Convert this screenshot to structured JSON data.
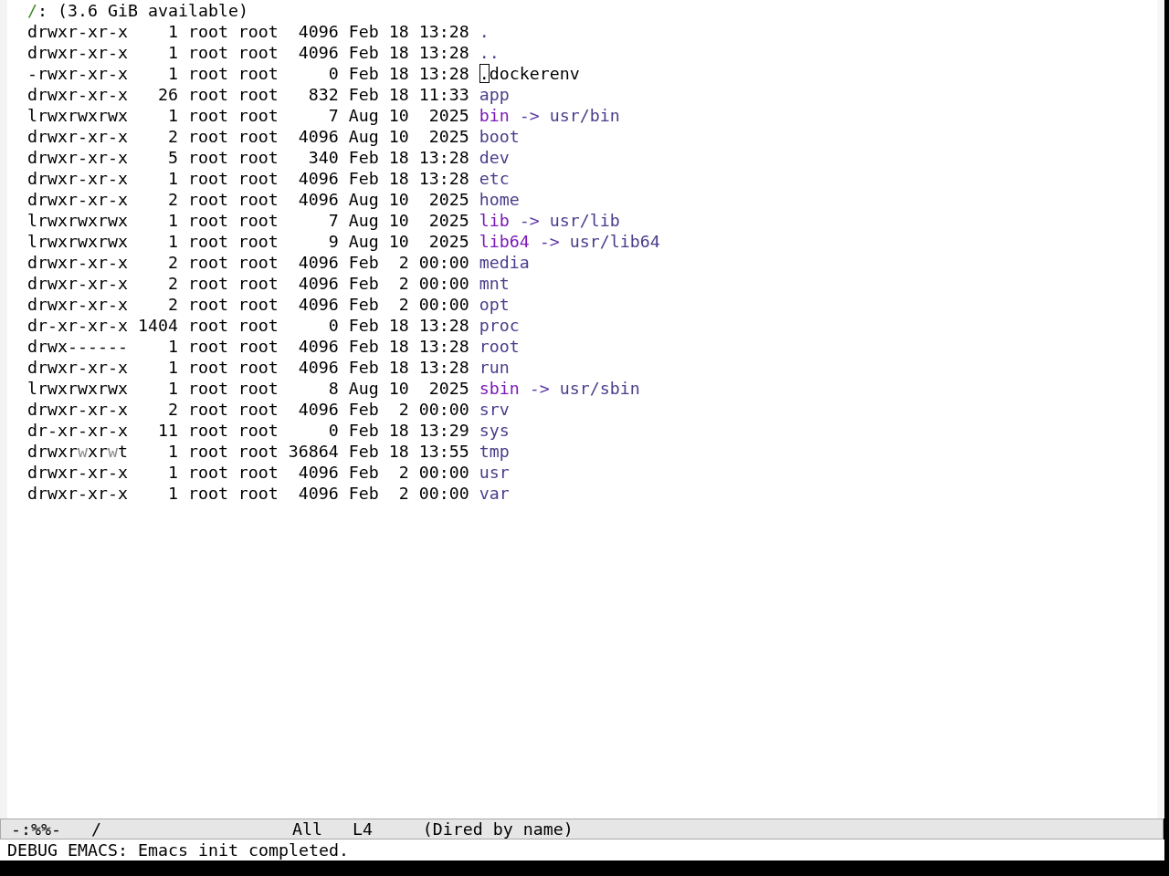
{
  "header": {
    "directory": "/",
    "info": ": (3.6 GiB available)"
  },
  "entries": [
    {
      "kind": "directory",
      "permissions": "drwxr-xr-x",
      "write_highlight": false,
      "links": "1",
      "owner": "root",
      "group": "root",
      "size": "4096",
      "date": "Feb 18 13:28",
      "name": ".",
      "cursor": false
    },
    {
      "kind": "directory",
      "permissions": "drwxr-xr-x",
      "write_highlight": false,
      "links": "1",
      "owner": "root",
      "group": "root",
      "size": "4096",
      "date": "Feb 18 13:28",
      "name": "..",
      "cursor": false
    },
    {
      "kind": "file",
      "permissions": "-rwxr-xr-x",
      "write_highlight": false,
      "links": "1",
      "owner": "root",
      "group": "root",
      "size": "0",
      "date": "Feb 18 13:28",
      "name": ".dockerenv",
      "cursor": true
    },
    {
      "kind": "directory",
      "permissions": "drwxr-xr-x",
      "write_highlight": false,
      "links": "26",
      "owner": "root",
      "group": "root",
      "size": "832",
      "date": "Feb 18 11:33",
      "name": "app",
      "cursor": false
    },
    {
      "kind": "symlink",
      "permissions": "lrwxrwxrwx",
      "write_highlight": false,
      "links": "1",
      "owner": "root",
      "group": "root",
      "size": "7",
      "date": "Aug 10  2025",
      "name": "bin",
      "arrow": "->",
      "target": "usr/bin",
      "cursor": false
    },
    {
      "kind": "directory",
      "permissions": "drwxr-xr-x",
      "write_highlight": false,
      "links": "2",
      "owner": "root",
      "group": "root",
      "size": "4096",
      "date": "Aug 10  2025",
      "name": "boot",
      "cursor": false
    },
    {
      "kind": "directory",
      "permissions": "drwxr-xr-x",
      "write_highlight": false,
      "links": "5",
      "owner": "root",
      "group": "root",
      "size": "340",
      "date": "Feb 18 13:28",
      "name": "dev",
      "cursor": false
    },
    {
      "kind": "directory",
      "permissions": "drwxr-xr-x",
      "write_highlight": false,
      "links": "1",
      "owner": "root",
      "group": "root",
      "size": "4096",
      "date": "Feb 18 13:28",
      "name": "etc",
      "cursor": false
    },
    {
      "kind": "directory",
      "permissions": "drwxr-xr-x",
      "write_highlight": false,
      "links": "2",
      "owner": "root",
      "group": "root",
      "size": "4096",
      "date": "Aug 10  2025",
      "name": "home",
      "cursor": false
    },
    {
      "kind": "symlink",
      "permissions": "lrwxrwxrwx",
      "write_highlight": false,
      "links": "1",
      "owner": "root",
      "group": "root",
      "size": "7",
      "date": "Aug 10  2025",
      "name": "lib",
      "arrow": "->",
      "target": "usr/lib",
      "cursor": false
    },
    {
      "kind": "symlink",
      "permissions": "lrwxrwxrwx",
      "write_highlight": false,
      "links": "1",
      "owner": "root",
      "group": "root",
      "size": "9",
      "date": "Aug 10  2025",
      "name": "lib64",
      "arrow": "->",
      "target": "usr/lib64",
      "cursor": false
    },
    {
      "kind": "directory",
      "permissions": "drwxr-xr-x",
      "write_highlight": false,
      "links": "2",
      "owner": "root",
      "group": "root",
      "size": "4096",
      "date": "Feb  2 00:00",
      "name": "media",
      "cursor": false
    },
    {
      "kind": "directory",
      "permissions": "drwxr-xr-x",
      "write_highlight": false,
      "links": "2",
      "owner": "root",
      "group": "root",
      "size": "4096",
      "date": "Feb  2 00:00",
      "name": "mnt",
      "cursor": false
    },
    {
      "kind": "directory",
      "permissions": "drwxr-xr-x",
      "write_highlight": false,
      "links": "2",
      "owner": "root",
      "group": "root",
      "size": "4096",
      "date": "Feb  2 00:00",
      "name": "opt",
      "cursor": false
    },
    {
      "kind": "directory",
      "permissions": "dr-xr-xr-x",
      "write_highlight": false,
      "links": "1404",
      "owner": "root",
      "group": "root",
      "size": "0",
      "date": "Feb 18 13:28",
      "name": "proc",
      "cursor": false
    },
    {
      "kind": "directory",
      "permissions": "drwx------",
      "write_highlight": false,
      "links": "1",
      "owner": "root",
      "group": "root",
      "size": "4096",
      "date": "Feb 18 13:28",
      "name": "root",
      "cursor": false
    },
    {
      "kind": "directory",
      "permissions": "drwxr-xr-x",
      "write_highlight": false,
      "links": "1",
      "owner": "root",
      "group": "root",
      "size": "4096",
      "date": "Feb 18 13:28",
      "name": "run",
      "cursor": false
    },
    {
      "kind": "symlink",
      "permissions": "lrwxrwxrwx",
      "write_highlight": false,
      "links": "1",
      "owner": "root",
      "group": "root",
      "size": "8",
      "date": "Aug 10  2025",
      "name": "sbin",
      "arrow": "->",
      "target": "usr/sbin",
      "cursor": false
    },
    {
      "kind": "directory",
      "permissions": "drwxr-xr-x",
      "write_highlight": false,
      "links": "2",
      "owner": "root",
      "group": "root",
      "size": "4096",
      "date": "Feb  2 00:00",
      "name": "srv",
      "cursor": false
    },
    {
      "kind": "directory",
      "permissions": "dr-xr-xr-x",
      "write_highlight": false,
      "links": "11",
      "owner": "root",
      "group": "root",
      "size": "0",
      "date": "Feb 18 13:29",
      "name": "sys",
      "cursor": false
    },
    {
      "kind": "directory",
      "permissions": "drwxrwxrwt",
      "write_highlight": true,
      "links": "1",
      "owner": "root",
      "group": "root",
      "size": "36864",
      "date": "Feb 18 13:55",
      "name": "tmp",
      "cursor": false
    },
    {
      "kind": "directory",
      "permissions": "drwxr-xr-x",
      "write_highlight": false,
      "links": "1",
      "owner": "root",
      "group": "root",
      "size": "4096",
      "date": "Feb  2 00:00",
      "name": "usr",
      "cursor": false
    },
    {
      "kind": "directory",
      "permissions": "drwxr-xr-x",
      "write_highlight": false,
      "links": "1",
      "owner": "root",
      "group": "root",
      "size": "4096",
      "date": "Feb  2 00:00",
      "name": "var",
      "cursor": false
    }
  ],
  "mode_line": {
    "status": "-:%%-",
    "buffer": "/",
    "position": "All",
    "line": "L4",
    "mode": "(Dired by name)"
  },
  "echo_area": "DEBUG EMACS: Emacs init completed."
}
